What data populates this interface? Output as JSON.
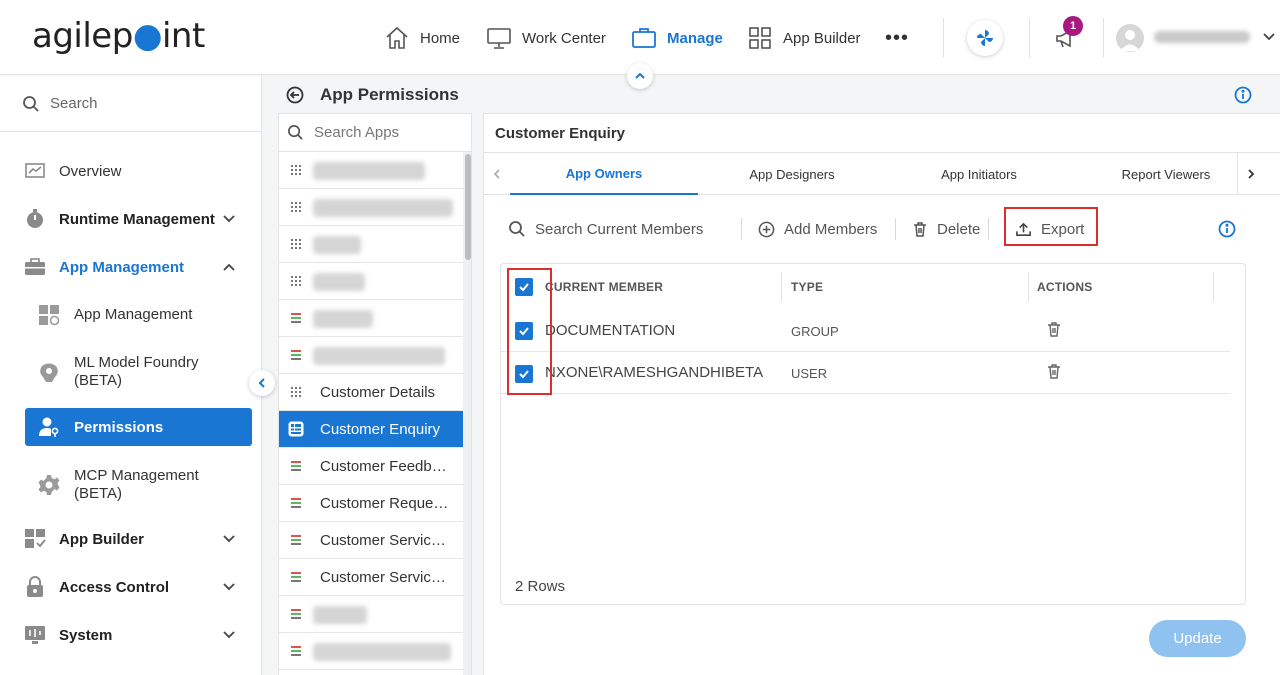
{
  "brand": {
    "logo_text_a": "agilep",
    "logo_text_b": "int"
  },
  "topnav": {
    "items": [
      {
        "label": "Home",
        "icon": "home-icon"
      },
      {
        "label": "Work Center",
        "icon": "monitor-icon"
      },
      {
        "label": "Manage",
        "icon": "briefcase-icon",
        "active": true
      },
      {
        "label": "App Builder",
        "icon": "grid-icon"
      }
    ],
    "more": "•••",
    "notification_count": "1"
  },
  "sidebar": {
    "search_placeholder": "Search",
    "items": [
      {
        "label": "Overview",
        "icon": "chart-icon"
      },
      {
        "label": "Runtime Management",
        "icon": "timer-icon",
        "expandable": true
      },
      {
        "label": "App Management",
        "icon": "briefcase-icon",
        "expanded": true
      },
      {
        "label": "App Management",
        "icon": "widgets-icon",
        "sub": true
      },
      {
        "label": "ML Model Foundry (BETA)",
        "icon": "brain-icon",
        "sub": true
      },
      {
        "label": "Permissions",
        "icon": "user-key-icon",
        "sub": true,
        "active": true
      },
      {
        "label": "MCP Management (BETA)",
        "icon": "gear-icon",
        "sub": true
      },
      {
        "label": "App Builder",
        "icon": "grid-icon",
        "expandable": true
      },
      {
        "label": "Access Control",
        "icon": "lock-icon",
        "expandable": true
      },
      {
        "label": "System",
        "icon": "system-icon",
        "expandable": true
      }
    ]
  },
  "page": {
    "title": "App Permissions"
  },
  "apps": {
    "search_placeholder": "Search Apps",
    "items": [
      {
        "label": "Customer Details"
      },
      {
        "label": "Customer Enquiry",
        "selected": true
      },
      {
        "label": "Customer Feedb…"
      },
      {
        "label": "Customer Reque…"
      },
      {
        "label": "Customer Servic…"
      },
      {
        "label": "Customer Servic…"
      }
    ]
  },
  "detail": {
    "title": "Customer Enquiry",
    "tabs": [
      "App Owners",
      "App Designers",
      "App Initiators",
      "Report Viewers"
    ],
    "toolbar": {
      "search_placeholder": "Search Current Members",
      "add": "Add Members",
      "delete": "Delete",
      "export": "Export"
    },
    "table": {
      "columns": [
        "CURRENT MEMBER",
        "TYPE",
        "ACTIONS"
      ],
      "rows": [
        {
          "member": "DOCUMENTATION",
          "type": "GROUP",
          "checked": true
        },
        {
          "member": "NXONE\\RAMESHGANDHIBETA",
          "type": "USER",
          "checked": true
        }
      ],
      "row_count": "2 Rows"
    },
    "update_label": "Update"
  },
  "colors": {
    "accent": "#1976d2",
    "highlight": "#d9302c",
    "badge": "#a8197f",
    "update_disabled": "#90c2ef"
  }
}
